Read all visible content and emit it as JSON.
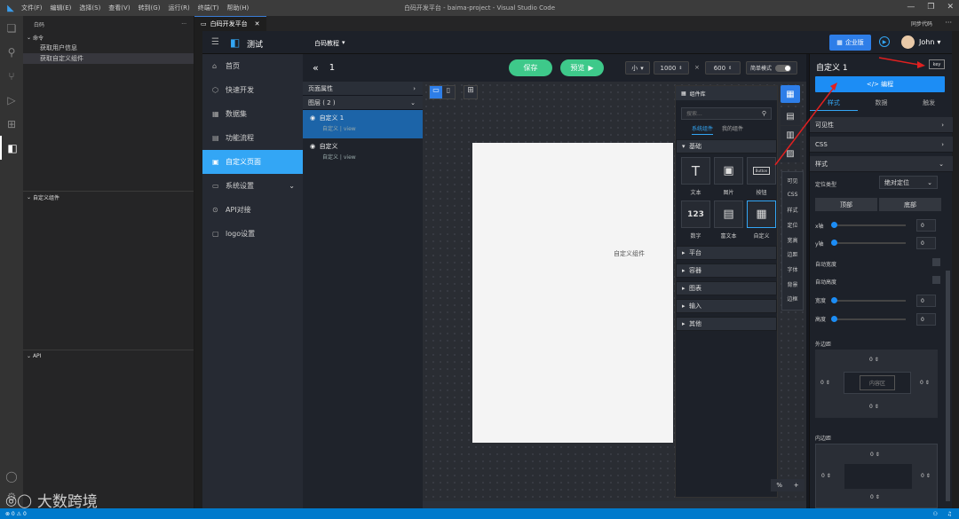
{
  "titlebar": {
    "menu": [
      "文件(F)",
      "编辑(E)",
      "选择(S)",
      "查看(V)",
      "转到(G)",
      "运行(R)",
      "终端(T)",
      "帮助(H)"
    ],
    "window_title": "白码开发平台 - baima-project - Visual Studio Code"
  },
  "sidebar": {
    "header": "白码",
    "sections": [
      {
        "title": "命令",
        "items": [
          "获取用户信息",
          "获取自定义组件"
        ]
      },
      {
        "title": "自定义组件"
      },
      {
        "title": "API"
      }
    ]
  },
  "editor_tab": {
    "label": "白码开发平台",
    "sync": "同步代码"
  },
  "app": {
    "project": "测试",
    "tutorial": "白码教程",
    "enterprise": "企业版",
    "user": "John",
    "nav": [
      "首页",
      "快速开发",
      "数据集",
      "功能流程",
      "自定义页面",
      "系统设置",
      "API对接",
      "logo设置"
    ],
    "active_nav": "自定义页面",
    "page_number": "1",
    "toolbar": {
      "save": "保存",
      "preview": "预览",
      "size": "小",
      "width": "1000",
      "height": "600",
      "mode": "简单模式"
    },
    "layers": {
      "page_props": "页面属性",
      "layer_group": "图层 ( 2 )",
      "items": [
        {
          "name": "自定义 1",
          "type": "自定义",
          "sub": "view"
        },
        {
          "name": "自定义",
          "type": "自定义",
          "sub": "view"
        }
      ]
    },
    "canvas_label": "自定义组件",
    "components": {
      "title": "组件库",
      "search_placeholder": "搜索...",
      "tab_system": "系统组件",
      "tab_mine": "我的组件",
      "basic": "基础",
      "items": [
        {
          "glyph": "T",
          "label": "文本"
        },
        {
          "glyph": "▣",
          "label": "图片"
        },
        {
          "glyph": "Button",
          "label": "按钮"
        },
        {
          "glyph": "123",
          "label": "数字"
        },
        {
          "glyph": "▤",
          "label": "富文本"
        },
        {
          "glyph": "▦",
          "label": "自定义"
        }
      ],
      "categories": [
        "平台",
        "容器",
        "图表",
        "输入",
        "其他"
      ]
    },
    "vmenu": [
      "可见",
      "CSS",
      "样式",
      "定位",
      "宽高",
      "边距",
      "字体",
      "背景",
      "边框"
    ],
    "zoom_suffix": "%",
    "props": {
      "title": "自定义 1",
      "key": "key",
      "code_button": "</> 编程",
      "tabs": [
        "样式",
        "数据",
        "触发"
      ],
      "visibility": "可见性",
      "css": "CSS",
      "style": "样式",
      "position_label": "定位类型",
      "position_value": "绝对定位",
      "top_btn": "顶部",
      "bottom_btn": "底部",
      "x_label": "x轴",
      "x": "0",
      "y_label": "y轴",
      "y": "0",
      "auto_width": "自动宽度",
      "auto_height": "自动高度",
      "width_label": "宽度",
      "width": "0",
      "height_label": "高度",
      "height": "0",
      "margin_label": "外边距",
      "padding_label": "内边距",
      "content_area": "内容区",
      "zero": "0"
    }
  },
  "watermark": "大数跨境",
  "status": {
    "left": "⊗ 0 ⚠ 0"
  },
  "colors": {
    "accent": "#33a6f5",
    "green": "#3ec98a",
    "blue_btn": "#1c8df5",
    "status": "#007acc"
  }
}
